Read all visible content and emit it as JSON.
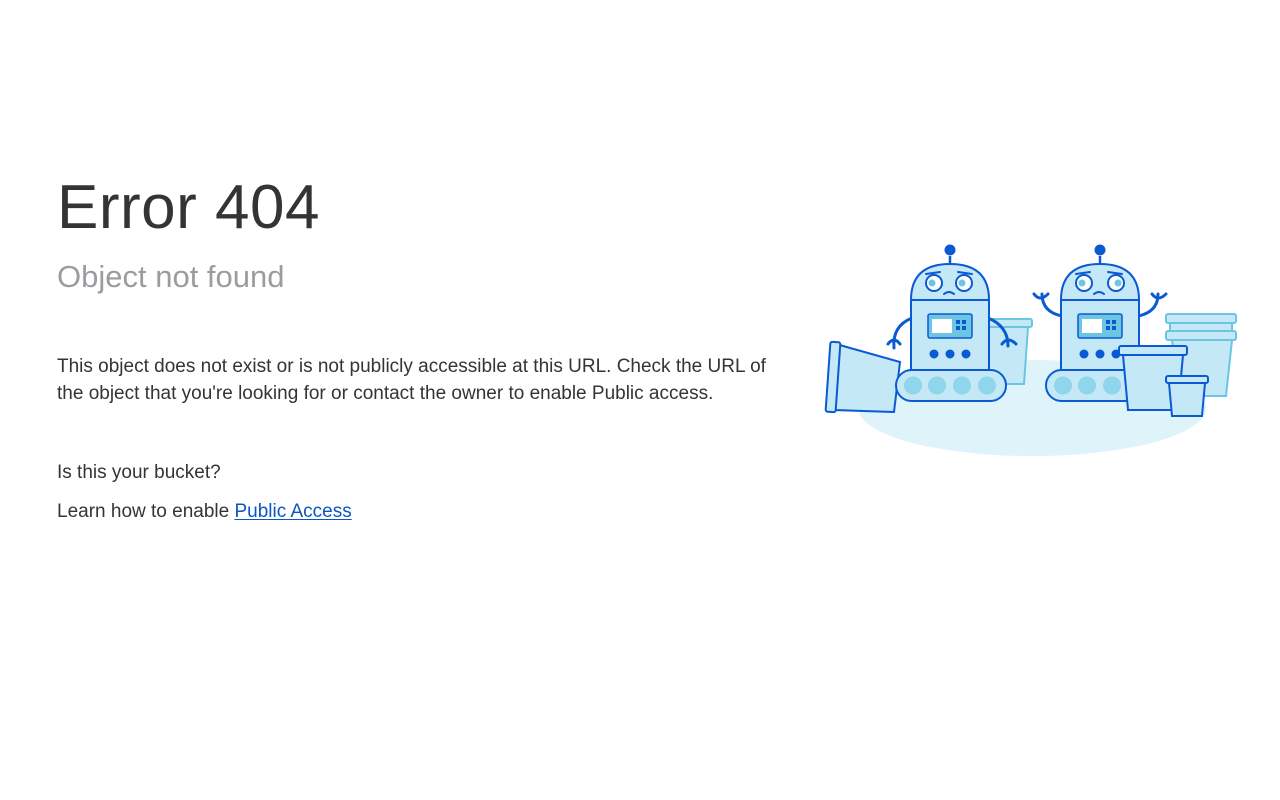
{
  "error": {
    "title": "Error 404",
    "subtitle": "Object not found",
    "description": "This object does not exist or is not publicly accessible at this URL. Check the URL of the object that you're looking for or contact the owner to enable Public access."
  },
  "bucket": {
    "question": "Is this your bucket?",
    "learn_prefix": "Learn how to enable ",
    "link_label": "Public Access"
  },
  "illustration": {
    "icon": "robots-with-buckets-illustration"
  },
  "colors": {
    "heading": "#333436",
    "muted": "#9a9c9f",
    "link": "#0a56c4",
    "accent_blue": "#0a5ad4",
    "light_blue": "#c4e8f5"
  }
}
